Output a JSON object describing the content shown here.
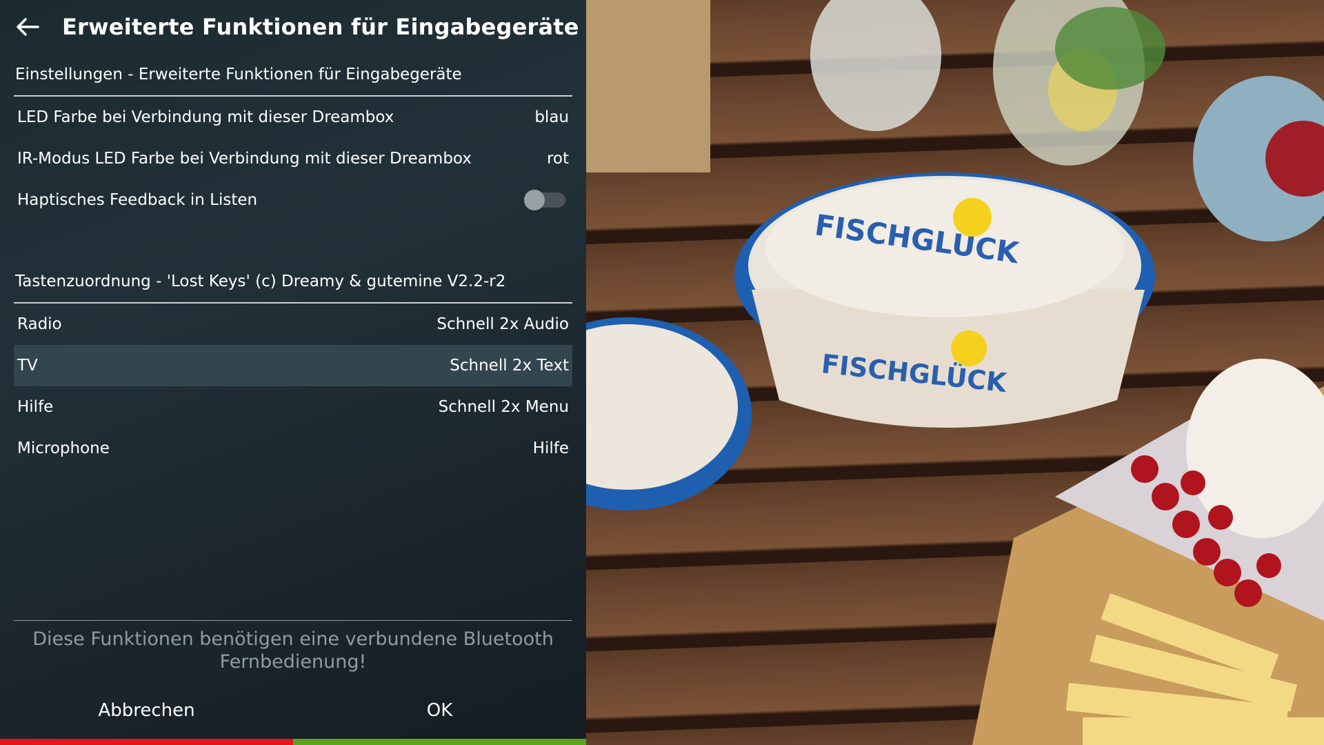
{
  "header": {
    "title": "Erweiterte Funktionen für Eingabegeräte",
    "back_icon": "back-arrow-icon"
  },
  "section1": {
    "title": "Einstellungen - Erweiterte Funktionen für Eingabegeräte",
    "rows": [
      {
        "label": "LED Farbe bei Verbindung mit dieser Dreambox",
        "value": "blau"
      },
      {
        "label": "IR-Modus LED Farbe bei Verbindung mit dieser Dreambox",
        "value": "rot"
      },
      {
        "label": "Haptisches Feedback in Listen",
        "toggle": "off"
      }
    ]
  },
  "section2": {
    "title": "Tastenzuordnung - 'Lost Keys' (c) Dreamy & gutemine V2.2-r2",
    "rows": [
      {
        "label": "Radio",
        "value": "Schnell 2x Audio"
      },
      {
        "label": "TV",
        "value": "Schnell 2x Text",
        "selected": true
      },
      {
        "label": "Hilfe",
        "value": "Schnell 2x Menu"
      },
      {
        "label": "Microphone",
        "value": "Hilfe"
      }
    ]
  },
  "footer": {
    "info_line1": "Diese Funktionen benötigen eine verbundene Bluetooth",
    "info_line2": "Fernbedienung!",
    "cancel_label": "Abbrechen",
    "ok_label": "OK"
  },
  "colors": {
    "red_key": "#e4161b",
    "green_key": "#5aa51c",
    "selection": "#33454f"
  }
}
